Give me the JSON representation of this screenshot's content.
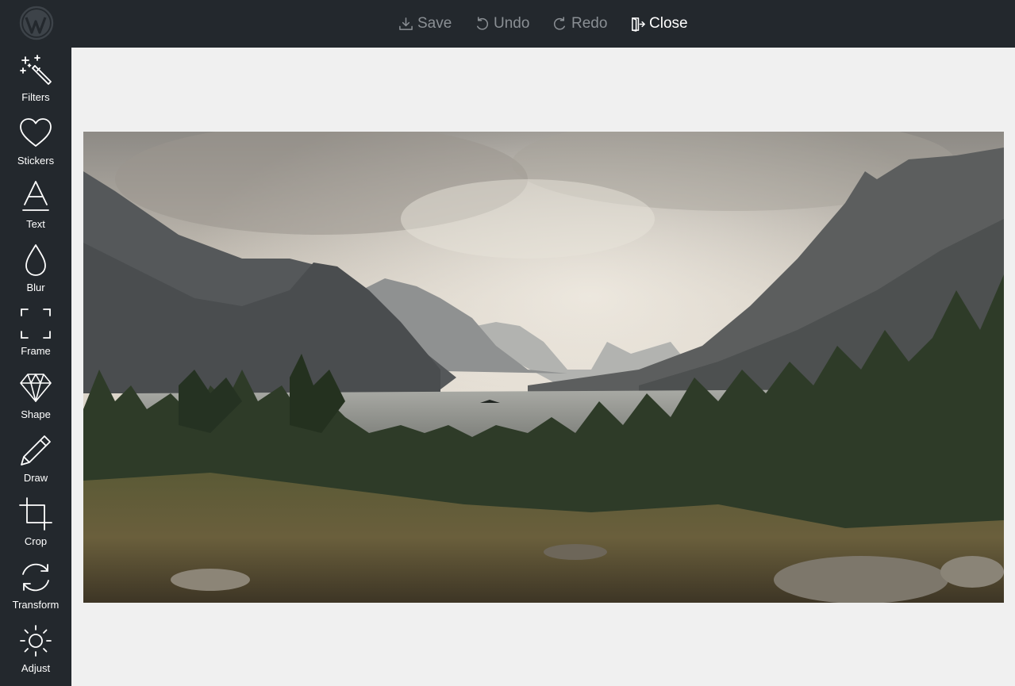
{
  "toolbar": {
    "save_label": "Save",
    "undo_label": "Undo",
    "redo_label": "Redo",
    "close_label": "Close"
  },
  "tools": [
    {
      "label": "Filters",
      "icon": "magic-wand-icon"
    },
    {
      "label": "Stickers",
      "icon": "heart-icon"
    },
    {
      "label": "Text",
      "icon": "text-icon"
    },
    {
      "label": "Blur",
      "icon": "droplet-icon"
    },
    {
      "label": "Frame",
      "icon": "frame-icon"
    },
    {
      "label": "Shape",
      "icon": "diamond-icon"
    },
    {
      "label": "Draw",
      "icon": "pencil-icon"
    },
    {
      "label": "Crop",
      "icon": "crop-icon"
    },
    {
      "label": "Transform",
      "icon": "transform-icon"
    },
    {
      "label": "Adjust",
      "icon": "sun-icon"
    }
  ],
  "image": {
    "subject": "mountain lake landscape with pine forest"
  },
  "colors": {
    "chrome": "#23282d",
    "canvas": "#f0f0f0",
    "inactive_text": "#8a8f94",
    "active_text": "#ffffff"
  }
}
